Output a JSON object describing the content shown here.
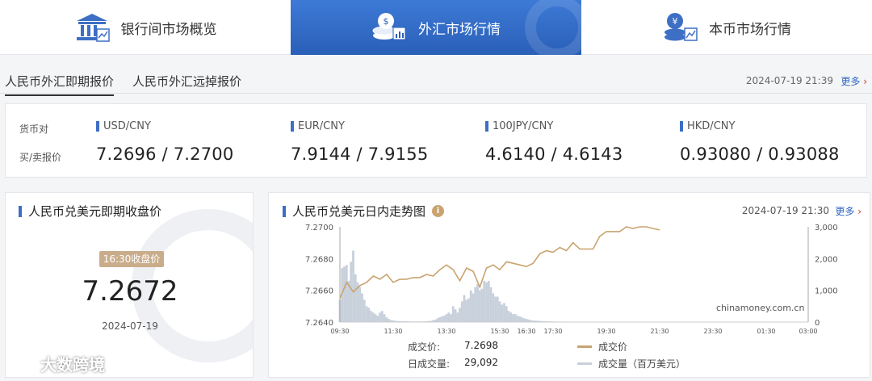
{
  "nav": {
    "tabs": [
      {
        "label": "银行间市场概览",
        "active": false,
        "icon": "bank-chart-icon"
      },
      {
        "label": "外汇市场行情",
        "active": true,
        "icon": "coins-chart-icon"
      },
      {
        "label": "本币市场行情",
        "active": false,
        "icon": "yen-coins-icon"
      }
    ]
  },
  "subtabs": {
    "items": [
      {
        "label": "人民币外汇即期报价",
        "active": true
      },
      {
        "label": "人民币外汇远掉报价",
        "active": false
      }
    ],
    "timestamp": "2024-07-19 21:39",
    "more_label": "更多"
  },
  "quotes": {
    "row_label_pair": "货币对",
    "row_label_price": "买/卖报价",
    "items": [
      {
        "pair": "USD/CNY",
        "price": "7.2696 / 7.2700"
      },
      {
        "pair": "EUR/CNY",
        "price": "7.9144 / 7.9155"
      },
      {
        "pair": "100JPY/CNY",
        "price": "4.6140 / 4.6143"
      },
      {
        "pair": "HKD/CNY",
        "price": "0.93080 / 0.93088"
      }
    ]
  },
  "closing": {
    "title": "人民币兑美元即期收盘价",
    "badge": "16:30收盘价",
    "price": "7.2672",
    "date": "2024-07-19"
  },
  "intraday": {
    "title": "人民币兑美元日内走势图",
    "timestamp": "2024-07-19 21:30",
    "more_label": "更多",
    "info_icon": "info-icon",
    "watermark": "chinamoney.com.cn",
    "legend": {
      "deal_price_label": "成交价:",
      "deal_price_value": "7.2698",
      "deal_volume_label": "日成交量:",
      "deal_volume_value": "29,092",
      "series_price_label": "成交价",
      "series_volume_label": "成交量（百万美元）"
    }
  },
  "brand": {
    "text": "大数跨境",
    "icon": "brand-logo-icon"
  },
  "colors": {
    "accent_blue": "#2f66c2",
    "price_line": "#c9a36f",
    "volume_bar": "#c8d0dc",
    "more_arrow": "#c0392b"
  },
  "chart_data": {
    "type": "line",
    "title": "人民币兑美元日内走势图",
    "x_ticks": [
      "09:30",
      "11:30",
      "13:30",
      "15:30",
      "16:30",
      "17:30",
      "19:30",
      "21:30",
      "23:30",
      "01:30",
      "03:00"
    ],
    "ylim_left": [
      7.264,
      7.27
    ],
    "y_ticks_left": [
      "7.2700",
      "7.2680",
      "7.2660",
      "7.2640"
    ],
    "ylim_right": [
      0,
      3000
    ],
    "y_ticks_right": [
      "3,000",
      "2,000",
      "1,000",
      "0"
    ],
    "grid": false,
    "series": [
      {
        "name": "成交价",
        "axis": "left",
        "x": [
          "09:30",
          "09:45",
          "10:00",
          "10:15",
          "10:30",
          "10:45",
          "11:00",
          "11:15",
          "11:30",
          "11:45",
          "12:00",
          "12:15",
          "12:30",
          "12:45",
          "13:00",
          "13:15",
          "13:30",
          "13:45",
          "14:00",
          "14:15",
          "14:30",
          "14:45",
          "15:00",
          "15:15",
          "15:30",
          "15:45",
          "16:00",
          "16:15",
          "16:30",
          "16:45",
          "17:00",
          "17:15",
          "17:30",
          "17:45",
          "18:00",
          "18:15",
          "18:30",
          "18:45",
          "19:00",
          "19:15",
          "19:30",
          "19:45",
          "20:00",
          "20:15",
          "20:30",
          "20:45",
          "21:00",
          "21:15",
          "21:30"
        ],
        "y": [
          7.2655,
          7.2665,
          7.2659,
          7.2663,
          7.2665,
          7.2669,
          7.2667,
          7.267,
          7.2665,
          7.2667,
          7.2667,
          7.2668,
          7.2668,
          7.267,
          7.2669,
          7.2673,
          7.2676,
          7.2673,
          7.2666,
          7.2674,
          7.2672,
          7.2662,
          7.2674,
          7.2676,
          7.2673,
          7.2678,
          7.2677,
          7.2676,
          7.2675,
          7.2677,
          7.2683,
          7.2685,
          7.2684,
          7.2687,
          7.2685,
          7.269,
          7.2686,
          7.2686,
          7.2686,
          7.2694,
          7.2697,
          7.2697,
          7.2697,
          7.27,
          7.2699,
          7.27,
          7.27,
          7.2699,
          7.2698
        ]
      },
      {
        "name": "成交量（百万美元）",
        "axis": "right",
        "type": "bar",
        "x": [
          "09:30",
          "09:35",
          "09:40",
          "09:45",
          "09:50",
          "09:55",
          "10:00",
          "10:05",
          "10:10",
          "10:15",
          "10:20",
          "10:25",
          "10:30",
          "10:35",
          "10:40",
          "10:45",
          "10:50",
          "10:55",
          "11:00",
          "11:05",
          "11:10",
          "11:15",
          "11:20",
          "11:25",
          "11:30",
          "11:35",
          "11:40",
          "11:45",
          "11:50",
          "11:55",
          "12:00",
          "12:05",
          "12:10",
          "12:15",
          "12:20",
          "12:25",
          "12:30",
          "12:35",
          "12:40",
          "12:45",
          "12:50",
          "12:55",
          "13:00",
          "13:05",
          "13:10",
          "13:15",
          "13:20",
          "13:25",
          "13:30",
          "13:35",
          "13:40",
          "13:45",
          "13:50",
          "13:55",
          "14:00",
          "14:05",
          "14:10",
          "14:15",
          "14:20",
          "14:25",
          "14:30",
          "14:35",
          "14:40",
          "14:45",
          "14:50",
          "14:55",
          "15:00",
          "15:05",
          "15:10",
          "15:15",
          "15:20",
          "15:25",
          "15:30",
          "15:35",
          "15:40",
          "15:45",
          "15:50",
          "15:55",
          "16:00",
          "16:05",
          "16:10",
          "16:15",
          "16:20",
          "16:25",
          "16:30",
          "16:35",
          "16:40",
          "16:45",
          "16:50",
          "16:55",
          "17:00",
          "17:05",
          "17:10",
          "17:15",
          "17:20",
          "17:25",
          "17:30",
          "17:35",
          "17:40",
          "17:45",
          "17:50",
          "17:55",
          "18:00",
          "18:05",
          "18:10",
          "18:15",
          "18:20",
          "18:25",
          "18:30",
          "18:35",
          "18:40",
          "18:45",
          "18:50",
          "18:55"
        ],
        "y": [
          700,
          1700,
          1750,
          1800,
          1300,
          1900,
          2250,
          1500,
          1250,
          1100,
          900,
          700,
          500,
          450,
          350,
          300,
          250,
          200,
          300,
          350,
          250,
          150,
          100,
          60,
          50,
          40,
          30,
          30,
          30,
          30,
          25,
          25,
          20,
          20,
          20,
          20,
          20,
          20,
          20,
          25,
          30,
          40,
          60,
          80,
          120,
          150,
          180,
          200,
          250,
          300,
          250,
          500,
          400,
          300,
          450,
          650,
          850,
          700,
          750,
          1000,
          900,
          1100,
          1200,
          1000,
          1050,
          1300,
          1250,
          1300,
          1100,
          900,
          800,
          800,
          650,
          550,
          600,
          500,
          350,
          300,
          250,
          250,
          200,
          180,
          150,
          120,
          100,
          80,
          60,
          50,
          45,
          40,
          35,
          30,
          25,
          25,
          20,
          20,
          20,
          15,
          15,
          15,
          15,
          15,
          10,
          10,
          10,
          10,
          10,
          10,
          10,
          10,
          10,
          10,
          10,
          10
        ]
      }
    ]
  }
}
